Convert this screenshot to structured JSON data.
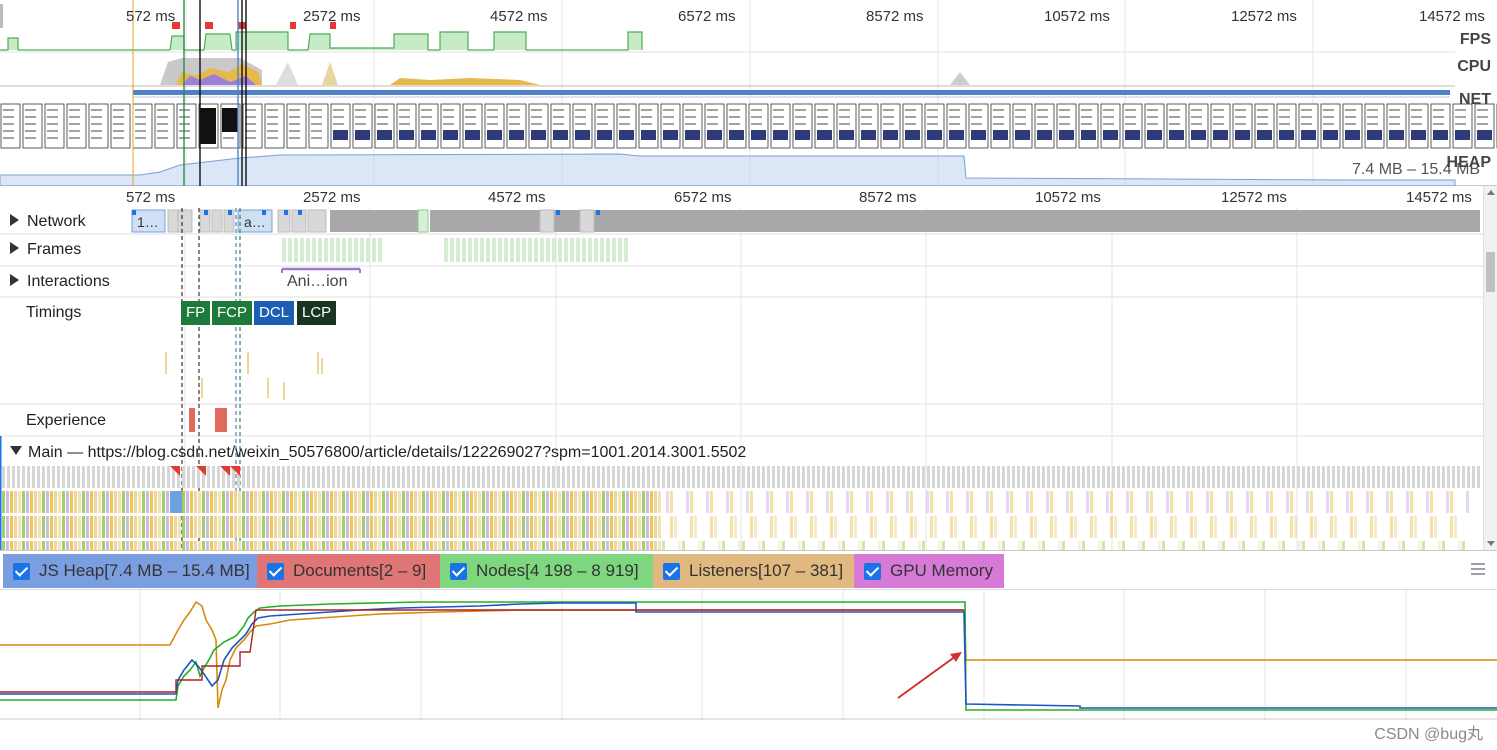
{
  "overview": {
    "ticks": [
      "572 ms",
      "2572 ms",
      "4572 ms",
      "6572 ms",
      "8572 ms",
      "10572 ms",
      "12572 ms",
      "14572 ms"
    ],
    "labels": {
      "fps": "FPS",
      "cpu": "CPU",
      "net": "NET",
      "heap": "HEAP"
    },
    "heap_range": "7.4 MB – 15.4 MB"
  },
  "ruler": {
    "ticks": [
      "572 ms",
      "2572 ms",
      "4572 ms",
      "6572 ms",
      "8572 ms",
      "10572 ms",
      "12572 ms",
      "14572 ms"
    ]
  },
  "tracks": {
    "network": {
      "label": "Network",
      "bar_labels": [
        "1…",
        "a…"
      ]
    },
    "frames": {
      "label": "Frames"
    },
    "interactions": {
      "label": "Interactions",
      "item": "Ani…ion"
    },
    "timings": {
      "label": "Timings",
      "markers": [
        {
          "label": "FP",
          "color": "#1e7a3b"
        },
        {
          "label": "FCP",
          "color": "#1e7a3b"
        },
        {
          "label": "DCL",
          "color": "#1a5fb4"
        },
        {
          "label": "LCP",
          "color": "#17351f"
        }
      ]
    },
    "experience": {
      "label": "Experience"
    },
    "main": {
      "label": "Main — https://blog.csdn.net/weixin_50576800/article/details/122269027?spm=1001.2014.3001.5502"
    }
  },
  "counters": [
    {
      "name": "js-heap",
      "label": "JS Heap[7.4 MB – 15.4 MB]",
      "color": "#7a9ee0",
      "line_color": "#1a56c8",
      "checked": true
    },
    {
      "name": "documents",
      "label": "Documents[2 – 9]",
      "color": "#e07575",
      "line_color": "#b02020",
      "checked": true
    },
    {
      "name": "nodes",
      "label": "Nodes[4 198 – 8 919]",
      "color": "#7ed67e",
      "line_color": "#22b022",
      "checked": true
    },
    {
      "name": "listeners",
      "label": "Listeners[107 – 381]",
      "color": "#e0b880",
      "line_color": "#d88a10",
      "checked": true
    },
    {
      "name": "gpu-memory",
      "label": "GPU Memory",
      "color": "#d77ad7",
      "checked": true
    }
  ],
  "icons": {
    "menu": "hamburger-menu-icon",
    "expand": "triangle-right-icon",
    "collapse": "triangle-down-icon",
    "annotation": "red-arrow-icon"
  },
  "watermark": "CSDN @bug丸"
}
